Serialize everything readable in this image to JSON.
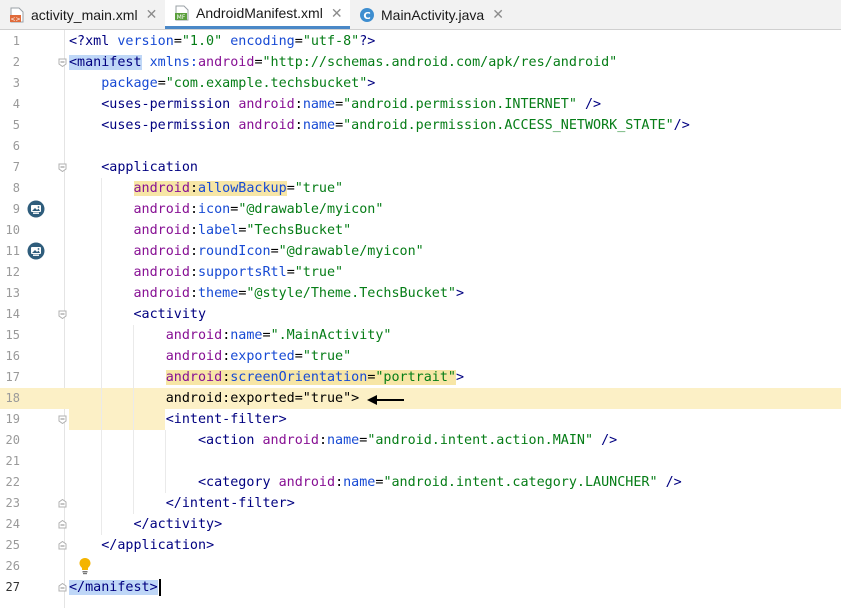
{
  "tabs": [
    {
      "label": "activity_main.xml",
      "icon": "xml-file-icon",
      "active": false
    },
    {
      "label": "AndroidManifest.xml",
      "icon": "manifest-file-icon",
      "active": true
    },
    {
      "label": "MainActivity.java",
      "icon": "java-class-icon",
      "active": false
    }
  ],
  "tab_icon_text": {
    "xml": "<>",
    "manifest": "MF",
    "java": "C"
  },
  "close_glyph": "✕",
  "code": {
    "lines": [
      {
        "n": "1",
        "tokens": [
          {
            "t": "<?",
            "c": "t-tag"
          },
          {
            "t": "xml",
            "c": "t-tag"
          },
          {
            "t": " ",
            "c": "t-plain"
          },
          {
            "t": "version",
            "c": "t-attrblue"
          },
          {
            "t": "=",
            "c": "t-plain"
          },
          {
            "t": "\"1.0\"",
            "c": "t-val"
          },
          {
            "t": " ",
            "c": "t-plain"
          },
          {
            "t": "encoding",
            "c": "t-attrblue"
          },
          {
            "t": "=",
            "c": "t-plain"
          },
          {
            "t": "\"utf-8\"",
            "c": "t-val"
          },
          {
            "t": "?>",
            "c": "t-tag"
          }
        ]
      },
      {
        "n": "2",
        "tokens": [
          {
            "t": "<manifest",
            "c": "t-tag t-mark"
          },
          {
            "t": " ",
            "c": "t-plain"
          },
          {
            "t": "xmlns:",
            "c": "t-attrblue"
          },
          {
            "t": "android",
            "c": "t-ns"
          },
          {
            "t": "=",
            "c": "t-plain"
          },
          {
            "t": "\"http://schemas.android.com/apk/res/android\"",
            "c": "t-val"
          }
        ]
      },
      {
        "n": "3",
        "tokens": [
          {
            "t": "    ",
            "c": "t-plain"
          },
          {
            "t": "package",
            "c": "t-attrblue"
          },
          {
            "t": "=",
            "c": "t-plain"
          },
          {
            "t": "\"com.example.techsbucket\"",
            "c": "t-val"
          },
          {
            "t": ">",
            "c": "t-tag"
          }
        ]
      },
      {
        "n": "4",
        "tokens": [
          {
            "t": "    ",
            "c": "t-plain"
          },
          {
            "t": "<uses-permission",
            "c": "t-tag"
          },
          {
            "t": " ",
            "c": "t-plain"
          },
          {
            "t": "android",
            "c": "t-ns"
          },
          {
            "t": ":",
            "c": "t-plain"
          },
          {
            "t": "name",
            "c": "t-attrblue"
          },
          {
            "t": "=",
            "c": "t-plain"
          },
          {
            "t": "\"android.permission.INTERNET\"",
            "c": "t-val"
          },
          {
            "t": " />",
            "c": "t-tag"
          }
        ]
      },
      {
        "n": "5",
        "tokens": [
          {
            "t": "    ",
            "c": "t-plain"
          },
          {
            "t": "<uses-permission",
            "c": "t-tag"
          },
          {
            "t": " ",
            "c": "t-plain"
          },
          {
            "t": "android",
            "c": "t-ns"
          },
          {
            "t": ":",
            "c": "t-plain"
          },
          {
            "t": "name",
            "c": "t-attrblue"
          },
          {
            "t": "=",
            "c": "t-plain"
          },
          {
            "t": "\"android.permission.ACCESS_NETWORK_STATE\"",
            "c": "t-val"
          },
          {
            "t": "/>",
            "c": "t-tag"
          }
        ]
      },
      {
        "n": "6",
        "tokens": []
      },
      {
        "n": "7",
        "tokens": [
          {
            "t": "    ",
            "c": "t-plain"
          },
          {
            "t": "<application",
            "c": "t-tag"
          }
        ]
      },
      {
        "n": "8",
        "tokens": [
          {
            "t": "        ",
            "c": "t-plain"
          },
          {
            "t": "android",
            "c": "t-ns t-hl-attr"
          },
          {
            "t": ":",
            "c": "t-plain t-hl-attr"
          },
          {
            "t": "allowBackup",
            "c": "t-attrblue t-hl-attr"
          },
          {
            "t": "=",
            "c": "t-plain"
          },
          {
            "t": "\"true\"",
            "c": "t-val"
          }
        ]
      },
      {
        "n": "9",
        "tokens": [
          {
            "t": "        ",
            "c": "t-plain"
          },
          {
            "t": "android",
            "c": "t-ns"
          },
          {
            "t": ":",
            "c": "t-plain"
          },
          {
            "t": "icon",
            "c": "t-attrblue"
          },
          {
            "t": "=",
            "c": "t-plain"
          },
          {
            "t": "\"@drawable/myicon\"",
            "c": "t-val"
          }
        ]
      },
      {
        "n": "10",
        "tokens": [
          {
            "t": "        ",
            "c": "t-plain"
          },
          {
            "t": "android",
            "c": "t-ns"
          },
          {
            "t": ":",
            "c": "t-plain"
          },
          {
            "t": "label",
            "c": "t-attrblue"
          },
          {
            "t": "=",
            "c": "t-plain"
          },
          {
            "t": "\"TechsBucket\"",
            "c": "t-val"
          }
        ]
      },
      {
        "n": "11",
        "tokens": [
          {
            "t": "        ",
            "c": "t-plain"
          },
          {
            "t": "android",
            "c": "t-ns"
          },
          {
            "t": ":",
            "c": "t-plain"
          },
          {
            "t": "roundIcon",
            "c": "t-attrblue"
          },
          {
            "t": "=",
            "c": "t-plain"
          },
          {
            "t": "\"@drawable/myicon\"",
            "c": "t-val"
          }
        ]
      },
      {
        "n": "12",
        "tokens": [
          {
            "t": "        ",
            "c": "t-plain"
          },
          {
            "t": "android",
            "c": "t-ns"
          },
          {
            "t": ":",
            "c": "t-plain"
          },
          {
            "t": "supportsRtl",
            "c": "t-attrblue"
          },
          {
            "t": "=",
            "c": "t-plain"
          },
          {
            "t": "\"true\"",
            "c": "t-val"
          }
        ]
      },
      {
        "n": "13",
        "tokens": [
          {
            "t": "        ",
            "c": "t-plain"
          },
          {
            "t": "android",
            "c": "t-ns"
          },
          {
            "t": ":",
            "c": "t-plain"
          },
          {
            "t": "theme",
            "c": "t-attrblue"
          },
          {
            "t": "=",
            "c": "t-plain"
          },
          {
            "t": "\"@style/Theme.TechsBucket\"",
            "c": "t-val"
          },
          {
            "t": ">",
            "c": "t-tag"
          }
        ]
      },
      {
        "n": "14",
        "tokens": [
          {
            "t": "        ",
            "c": "t-plain"
          },
          {
            "t": "<activity",
            "c": "t-tag"
          }
        ]
      },
      {
        "n": "15",
        "tokens": [
          {
            "t": "            ",
            "c": "t-plain"
          },
          {
            "t": "android",
            "c": "t-ns"
          },
          {
            "t": ":",
            "c": "t-plain"
          },
          {
            "t": "name",
            "c": "t-attrblue"
          },
          {
            "t": "=",
            "c": "t-plain"
          },
          {
            "t": "\".MainActivity\"",
            "c": "t-val"
          }
        ]
      },
      {
        "n": "16",
        "tokens": [
          {
            "t": "            ",
            "c": "t-plain"
          },
          {
            "t": "android",
            "c": "t-ns"
          },
          {
            "t": ":",
            "c": "t-plain"
          },
          {
            "t": "exported",
            "c": "t-attrblue"
          },
          {
            "t": "=",
            "c": "t-plain"
          },
          {
            "t": "\"true\"",
            "c": "t-val"
          }
        ]
      },
      {
        "n": "17",
        "tokens": [
          {
            "t": "            ",
            "c": "t-plain"
          },
          {
            "t": "android",
            "c": "t-ns t-hl-attr"
          },
          {
            "t": ":",
            "c": "t-plain t-hl-attr"
          },
          {
            "t": "screenOrientation",
            "c": "t-attrblue t-hl-attr"
          },
          {
            "t": "=",
            "c": "t-plain t-hl-attr"
          },
          {
            "t": "\"portrait\"",
            "c": "t-val t-hl-attr"
          },
          {
            "t": ">",
            "c": "t-tag"
          }
        ]
      },
      {
        "n": "18",
        "tokens": [
          {
            "t": "            ",
            "c": "t-plain"
          },
          {
            "t": "android:exported=\"true\">",
            "c": "t-plain"
          }
        ]
      },
      {
        "n": "19",
        "tokens": [
          {
            "t": "            ",
            "c": "t-plain"
          },
          {
            "t": "<intent-filter",
            "c": "t-tag"
          },
          {
            "t": ">",
            "c": "t-tag"
          }
        ]
      },
      {
        "n": "20",
        "tokens": [
          {
            "t": "                ",
            "c": "t-plain"
          },
          {
            "t": "<action",
            "c": "t-tag"
          },
          {
            "t": " ",
            "c": "t-plain"
          },
          {
            "t": "android",
            "c": "t-ns"
          },
          {
            "t": ":",
            "c": "t-plain"
          },
          {
            "t": "name",
            "c": "t-attrblue"
          },
          {
            "t": "=",
            "c": "t-plain"
          },
          {
            "t": "\"android.intent.action.MAIN\"",
            "c": "t-val"
          },
          {
            "t": " />",
            "c": "t-tag"
          }
        ]
      },
      {
        "n": "21",
        "tokens": []
      },
      {
        "n": "22",
        "tokens": [
          {
            "t": "                ",
            "c": "t-plain"
          },
          {
            "t": "<category",
            "c": "t-tag"
          },
          {
            "t": " ",
            "c": "t-plain"
          },
          {
            "t": "android",
            "c": "t-ns"
          },
          {
            "t": ":",
            "c": "t-plain"
          },
          {
            "t": "name",
            "c": "t-attrblue"
          },
          {
            "t": "=",
            "c": "t-plain"
          },
          {
            "t": "\"android.intent.category.LAUNCHER\"",
            "c": "t-val"
          },
          {
            "t": " />",
            "c": "t-tag"
          }
        ]
      },
      {
        "n": "23",
        "tokens": [
          {
            "t": "            ",
            "c": "t-plain"
          },
          {
            "t": "</intent-filter",
            "c": "t-tag"
          },
          {
            "t": ">",
            "c": "t-tag"
          }
        ]
      },
      {
        "n": "24",
        "tokens": [
          {
            "t": "        ",
            "c": "t-plain"
          },
          {
            "t": "</activity",
            "c": "t-tag"
          },
          {
            "t": ">",
            "c": "t-tag"
          }
        ]
      },
      {
        "n": "25",
        "tokens": [
          {
            "t": "    ",
            "c": "t-plain"
          },
          {
            "t": "</application",
            "c": "t-tag"
          },
          {
            "t": ">",
            "c": "t-tag"
          }
        ]
      },
      {
        "n": "26",
        "tokens": []
      },
      {
        "n": "27",
        "tokens": [
          {
            "t": "</manifest>",
            "c": "t-tag t-mark"
          }
        ]
      }
    ]
  },
  "colors": {
    "tag": "#000080",
    "namespace": "#871094",
    "attribute": "#174ad4",
    "value": "#067d17",
    "current_line": "#fcf0c6",
    "tab_underline": "#4a88c7"
  }
}
